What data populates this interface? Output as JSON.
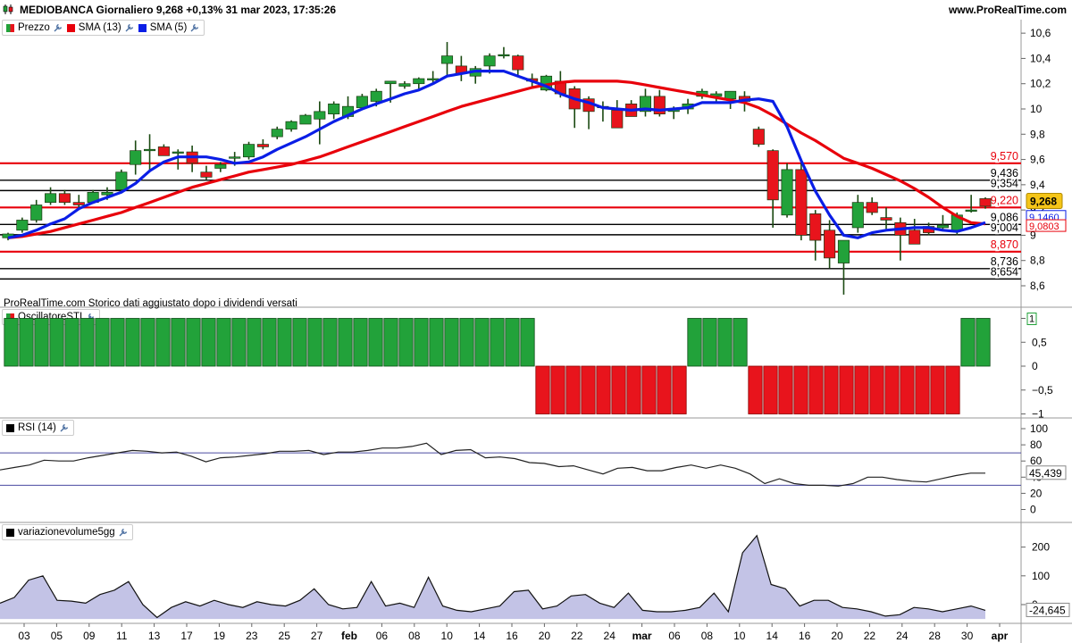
{
  "header": {
    "title": "MEDIOBANCA Giornaliero 9,268 +0,13% 31 mar 2023, 17:35:26",
    "site": "www.ProRealTime.com"
  },
  "legends": {
    "price": [
      "Prezzo",
      "SMA (13)",
      "SMA (5)"
    ],
    "sti": "OscillatoreSTI",
    "rsi": "RSI (14)",
    "vol": "variazionevolume5gg"
  },
  "colors": {
    "sma13": "#e8000b",
    "sma5": "#0a1ee6",
    "up": "#22a23a",
    "down": "#e8141c",
    "rsi_bound": "#4a4aa0",
    "vol_fill": "#b9b9e2"
  },
  "chart_data": [
    {
      "type": "candlestick",
      "title": "MEDIOBANCA Giornaliero",
      "note": "ProRealTime.com Storico dati aggiustato dopo i dividendi versati",
      "x_ticks": [
        "03",
        "05",
        "09",
        "11",
        "13",
        "17",
        "19",
        "23",
        "25",
        "27",
        "feb",
        "06",
        "08",
        "10",
        "14",
        "16",
        "20",
        "22",
        "24",
        "mar",
        "06",
        "08",
        "10",
        "14",
        "16",
        "20",
        "22",
        "24",
        "28",
        "30",
        "apr"
      ],
      "y_ticks": [
        "8,6",
        "8,8",
        "9",
        "9,2",
        "9,4",
        "9,6",
        "9,8",
        "10",
        "10,2",
        "10,4",
        "10,6"
      ],
      "ylim": [
        8.5,
        10.7
      ],
      "ohlc": [
        [
          8.98,
          9.02,
          8.96,
          9.01
        ],
        [
          9.04,
          9.14,
          9.02,
          9.12
        ],
        [
          9.12,
          9.28,
          9.1,
          9.24
        ],
        [
          9.26,
          9.38,
          9.24,
          9.33
        ],
        [
          9.33,
          9.36,
          9.24,
          9.26
        ],
        [
          9.26,
          9.32,
          9.2,
          9.24
        ],
        [
          9.26,
          9.36,
          9.25,
          9.34
        ],
        [
          9.32,
          9.38,
          9.28,
          9.34
        ],
        [
          9.36,
          9.52,
          9.34,
          9.5
        ],
        [
          9.56,
          9.75,
          9.48,
          9.67
        ],
        [
          9.68,
          9.8,
          9.5,
          9.68
        ],
        [
          9.7,
          9.72,
          9.63,
          9.63
        ],
        [
          9.66,
          9.68,
          9.52,
          9.66
        ],
        [
          9.66,
          9.71,
          9.5,
          9.57
        ],
        [
          9.5,
          9.55,
          9.44,
          9.46
        ],
        [
          9.53,
          9.58,
          9.5,
          9.56
        ],
        [
          9.61,
          9.66,
          9.55,
          9.62
        ],
        [
          9.62,
          9.74,
          9.6,
          9.72
        ],
        [
          9.72,
          9.76,
          9.68,
          9.7
        ],
        [
          9.78,
          9.86,
          9.76,
          9.84
        ],
        [
          9.84,
          9.91,
          9.82,
          9.9
        ],
        [
          9.88,
          9.96,
          9.88,
          9.95
        ],
        [
          9.92,
          10.06,
          9.72,
          9.98
        ],
        [
          9.96,
          10.06,
          9.92,
          10.04
        ],
        [
          9.94,
          10.1,
          9.92,
          10.02
        ],
        [
          10.01,
          10.12,
          10.0,
          10.1
        ],
        [
          10.06,
          10.16,
          10.02,
          10.14
        ],
        [
          10.2,
          10.22,
          10.05,
          10.22
        ],
        [
          10.18,
          10.22,
          10.16,
          10.2
        ],
        [
          10.2,
          10.25,
          10.16,
          10.24
        ],
        [
          10.24,
          10.3,
          10.2,
          10.24
        ],
        [
          10.36,
          10.53,
          10.26,
          10.42
        ],
        [
          10.34,
          10.42,
          10.22,
          10.28
        ],
        [
          10.26,
          10.34,
          10.2,
          10.32
        ],
        [
          10.34,
          10.44,
          10.28,
          10.42
        ],
        [
          10.42,
          10.49,
          10.4,
          10.43
        ],
        [
          10.42,
          10.43,
          10.26,
          10.31
        ],
        [
          10.24,
          10.28,
          10.17,
          10.22
        ],
        [
          10.15,
          10.27,
          10.14,
          10.26
        ],
        [
          10.22,
          10.3,
          10.09,
          10.12
        ],
        [
          10.16,
          10.18,
          9.85,
          10.0
        ],
        [
          10.08,
          10.1,
          9.84,
          9.98
        ],
        [
          10.02,
          10.06,
          9.9,
          10.02
        ],
        [
          9.99,
          10.07,
          9.85,
          9.85
        ],
        [
          10.04,
          10.07,
          9.96,
          9.94
        ],
        [
          9.98,
          10.16,
          9.94,
          10.1
        ],
        [
          10.1,
          10.15,
          9.94,
          9.96
        ],
        [
          9.98,
          10.02,
          9.92,
          10.0
        ],
        [
          10.0,
          10.08,
          9.96,
          10.04
        ],
        [
          10.1,
          10.16,
          10.08,
          10.14
        ],
        [
          10.1,
          10.14,
          10.04,
          10.12
        ],
        [
          10.08,
          10.14,
          10.0,
          10.14
        ],
        [
          10.1,
          10.14,
          9.98,
          10.06
        ],
        [
          9.84,
          9.86,
          9.7,
          9.72
        ],
        [
          9.67,
          9.68,
          9.06,
          9.28
        ],
        [
          9.16,
          9.57,
          9.14,
          9.52
        ],
        [
          9.52,
          9.58,
          8.96,
          9.0
        ],
        [
          9.17,
          9.2,
          8.8,
          8.96
        ],
        [
          9.04,
          9.12,
          8.74,
          8.82
        ],
        [
          8.78,
          8.96,
          8.53,
          8.96
        ],
        [
          9.06,
          9.32,
          9.02,
          9.26
        ],
        [
          9.26,
          9.3,
          9.16,
          9.18
        ],
        [
          9.14,
          9.22,
          9.05,
          9.12
        ],
        [
          9.1,
          9.14,
          8.8,
          9.0
        ],
        [
          9.04,
          9.13,
          8.94,
          8.93
        ],
        [
          9.07,
          9.1,
          9.0,
          9.02
        ],
        [
          9.06,
          9.16,
          9.04,
          9.08
        ],
        [
          9.04,
          9.18,
          9.0,
          9.16
        ],
        [
          9.2,
          9.32,
          9.18,
          9.2
        ],
        [
          9.29,
          9.3,
          9.21,
          9.23
        ]
      ],
      "sma13": [
        8.98,
        8.99,
        9.01,
        9.03,
        9.06,
        9.09,
        9.12,
        9.15,
        9.18,
        9.22,
        9.26,
        9.3,
        9.34,
        9.38,
        9.41,
        9.44,
        9.47,
        9.5,
        9.52,
        9.54,
        9.56,
        9.59,
        9.62,
        9.66,
        9.7,
        9.74,
        9.78,
        9.82,
        9.86,
        9.9,
        9.94,
        9.98,
        10.02,
        10.05,
        10.08,
        10.11,
        10.14,
        10.17,
        10.19,
        10.21,
        10.22,
        10.22,
        10.22,
        10.22,
        10.21,
        10.19,
        10.17,
        10.15,
        10.13,
        10.11,
        10.09,
        10.07,
        10.05,
        10.01,
        9.95,
        9.88,
        9.81,
        9.75,
        9.68,
        9.61,
        9.57,
        9.53,
        9.48,
        9.43,
        9.37,
        9.3,
        9.22,
        9.15,
        9.1,
        9.09
      ],
      "sma5": [
        8.98,
        9.0,
        9.04,
        9.09,
        9.13,
        9.21,
        9.26,
        9.3,
        9.34,
        9.41,
        9.51,
        9.58,
        9.62,
        9.62,
        9.62,
        9.6,
        9.57,
        9.58,
        9.62,
        9.68,
        9.73,
        9.78,
        9.84,
        9.9,
        9.95,
        10.0,
        10.04,
        10.08,
        10.12,
        10.15,
        10.2,
        10.26,
        10.28,
        10.3,
        10.3,
        10.3,
        10.26,
        10.22,
        10.18,
        10.12,
        10.08,
        10.05,
        10.01,
        10.0,
        9.99,
        10.0,
        9.99,
        10.0,
        10.01,
        10.05,
        10.05,
        10.05,
        10.07,
        10.08,
        10.06,
        9.86,
        9.59,
        9.35,
        9.16,
        9.0,
        8.98,
        9.02,
        9.04,
        9.05,
        9.06,
        9.06,
        9.04,
        9.03,
        9.06,
        9.1
      ],
      "levels": [
        {
          "value": 9.57,
          "label": "9,570",
          "color": "red"
        },
        {
          "value": 9.436,
          "label": "9,436",
          "color": "black"
        },
        {
          "value": 9.354,
          "label": "9,354",
          "color": "black"
        },
        {
          "value": 9.22,
          "label": "9,220",
          "color": "red"
        },
        {
          "value": 9.086,
          "label": "9,086",
          "color": "black"
        },
        {
          "value": 9.004,
          "label": "9,004",
          "color": "black"
        },
        {
          "value": 8.87,
          "label": "8,870",
          "color": "red"
        },
        {
          "value": 8.736,
          "label": "8,736",
          "color": "black"
        },
        {
          "value": 8.654,
          "label": "8,654",
          "color": "black"
        }
      ],
      "badges": [
        {
          "label": "9,268",
          "value": 9.268,
          "style": "price"
        },
        {
          "label": "9,1460",
          "value": 9.146,
          "style": "sma5"
        },
        {
          "label": "9,0803",
          "value": 9.0803,
          "style": "sma13"
        }
      ]
    },
    {
      "type": "bar",
      "title": "OscillatoreSTI",
      "y_ticks": [
        "1",
        "0,5",
        "0",
        "-0,5",
        "-1"
      ],
      "ylim": [
        -1,
        1
      ],
      "values": [
        1,
        1,
        1,
        1,
        1,
        1,
        1,
        1,
        1,
        1,
        1,
        1,
        1,
        1,
        1,
        1,
        1,
        1,
        1,
        1,
        1,
        1,
        1,
        1,
        1,
        1,
        1,
        1,
        1,
        1,
        1,
        1,
        1,
        1,
        1,
        -1,
        -1,
        -1,
        -1,
        -1,
        -1,
        -1,
        -1,
        -1,
        -1,
        1,
        1,
        1,
        1,
        -1,
        -1,
        -1,
        -1,
        -1,
        -1,
        -1,
        -1,
        -1,
        -1,
        -1,
        -1,
        -1,
        -1,
        1,
        1
      ]
    },
    {
      "type": "line",
      "title": "RSI (14)",
      "y_ticks": [
        "100",
        "80",
        "60",
        "40",
        "20",
        "0"
      ],
      "ylim": [
        0,
        100
      ],
      "bounds": [
        70,
        30
      ],
      "current_label": "45,439",
      "values": [
        49,
        52,
        55,
        61,
        60,
        60,
        64,
        67,
        70,
        73,
        72,
        70,
        71,
        66,
        59,
        64,
        65,
        67,
        69,
        72,
        72,
        73,
        68,
        71,
        71,
        73,
        76,
        76,
        78,
        82,
        68,
        73,
        74,
        64,
        65,
        63,
        58,
        57,
        53,
        54,
        49,
        44,
        51,
        52,
        48,
        48,
        52,
        55,
        51,
        55,
        51,
        44,
        32,
        38,
        32,
        30,
        30,
        29,
        32,
        40,
        40,
        37,
        35,
        34,
        38,
        42,
        45,
        45
      ]
    },
    {
      "type": "area",
      "title": "variazionevolume5gg",
      "y_ticks": [
        "200",
        "100",
        "0"
      ],
      "ylim": [
        -50,
        250
      ],
      "current_label": "-24,645",
      "values": [
        5,
        25,
        85,
        100,
        15,
        12,
        5,
        35,
        50,
        80,
        0,
        -45,
        -10,
        10,
        -5,
        15,
        0,
        -10,
        10,
        0,
        -5,
        15,
        55,
        0,
        -15,
        -10,
        80,
        -5,
        5,
        -10,
        95,
        -5,
        -20,
        -25,
        -15,
        -5,
        45,
        50,
        -15,
        -5,
        30,
        35,
        5,
        -10,
        40,
        -20,
        -25,
        -25,
        -20,
        -10,
        40,
        -25,
        180,
        240,
        70,
        55,
        -5,
        15,
        15,
        -10,
        -15,
        -25,
        -40,
        -35,
        -10,
        -15,
        -25,
        -15,
        -5,
        -20
      ]
    }
  ]
}
